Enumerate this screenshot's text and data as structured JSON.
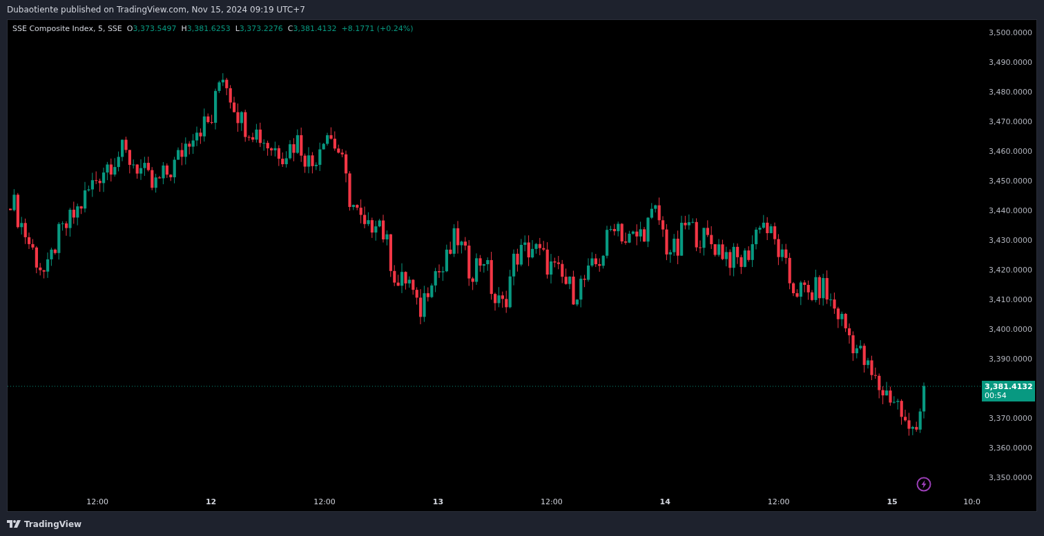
{
  "header": {
    "title": "Dubaotiente published on TradingView.com, Nov 15, 2024 09:19 UTC+7"
  },
  "legend": {
    "symbol": "SSE Composite Index, 5, SSE",
    "ohlc": [
      {
        "label": "O",
        "value": "3,373.5497"
      },
      {
        "label": "H",
        "value": "3,381.6253"
      },
      {
        "label": "L",
        "value": "3,373.2276"
      },
      {
        "label": "C",
        "value": "3,381.4132"
      }
    ],
    "change": "+8.1771 (+0.24%)"
  },
  "price_axis": {
    "ticks": [
      "3,500.0000",
      "3,490.0000",
      "3,480.0000",
      "3,470.0000",
      "3,460.0000",
      "3,450.0000",
      "3,440.0000",
      "3,430.0000",
      "3,420.0000",
      "3,410.0000",
      "3,400.0000",
      "3,390.0000",
      "3,370.0000",
      "3,360.0000",
      "3,350.0000"
    ],
    "current_price": "3,381.4132",
    "countdown": "00:54"
  },
  "time_axis": {
    "labels": [
      {
        "text": "12:00",
        "kind": "time"
      },
      {
        "text": "12",
        "kind": "day"
      },
      {
        "text": "12:00",
        "kind": "time"
      },
      {
        "text": "13",
        "kind": "day"
      },
      {
        "text": "12:00",
        "kind": "time"
      },
      {
        "text": "14",
        "kind": "day"
      },
      {
        "text": "12:00",
        "kind": "time"
      },
      {
        "text": "15",
        "kind": "day"
      },
      {
        "text": "10:0",
        "kind": "time"
      }
    ]
  },
  "footer": {
    "brand": "TradingView"
  }
}
